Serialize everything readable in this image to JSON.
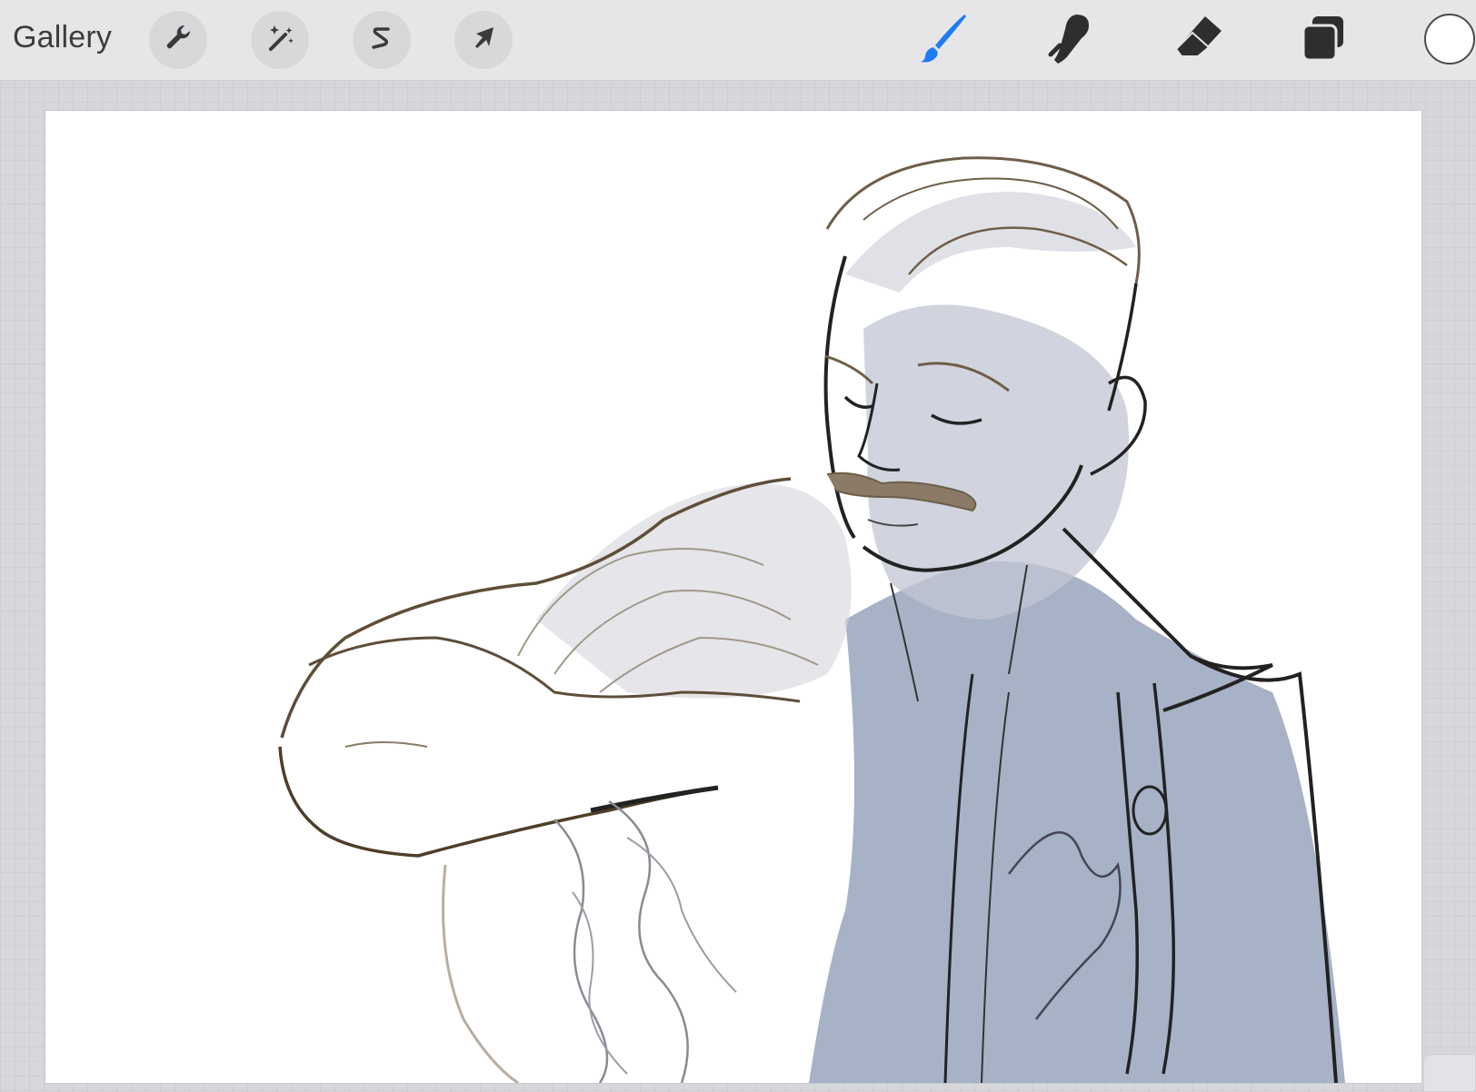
{
  "toolbar": {
    "gallery_label": "Gallery",
    "left_tools": [
      {
        "name": "actions",
        "icon": "wrench-icon"
      },
      {
        "name": "adjustments",
        "icon": "magic-wand-icon"
      },
      {
        "name": "selection",
        "icon": "selection-s-icon"
      },
      {
        "name": "transform",
        "icon": "arrow-cursor-icon"
      }
    ],
    "right_tools": [
      {
        "name": "brush",
        "icon": "brush-icon",
        "active": true
      },
      {
        "name": "smudge",
        "icon": "smudge-finger-icon",
        "active": false
      },
      {
        "name": "eraser",
        "icon": "eraser-icon",
        "active": false
      },
      {
        "name": "layers",
        "icon": "layers-icon",
        "active": false
      }
    ],
    "current_color": "#ffffff"
  },
  "colors": {
    "toolbar_bg": "#e6e6e8",
    "workspace_bg": "#d5d7da",
    "active_tool": "#1e7cf2",
    "icon": "#3a3a3c",
    "sketch_line": "#2a2a2c",
    "sketch_brown": "#7a6a55",
    "shading": "#8e9bb5"
  },
  "canvas": {
    "content": "sketch-illustration"
  }
}
